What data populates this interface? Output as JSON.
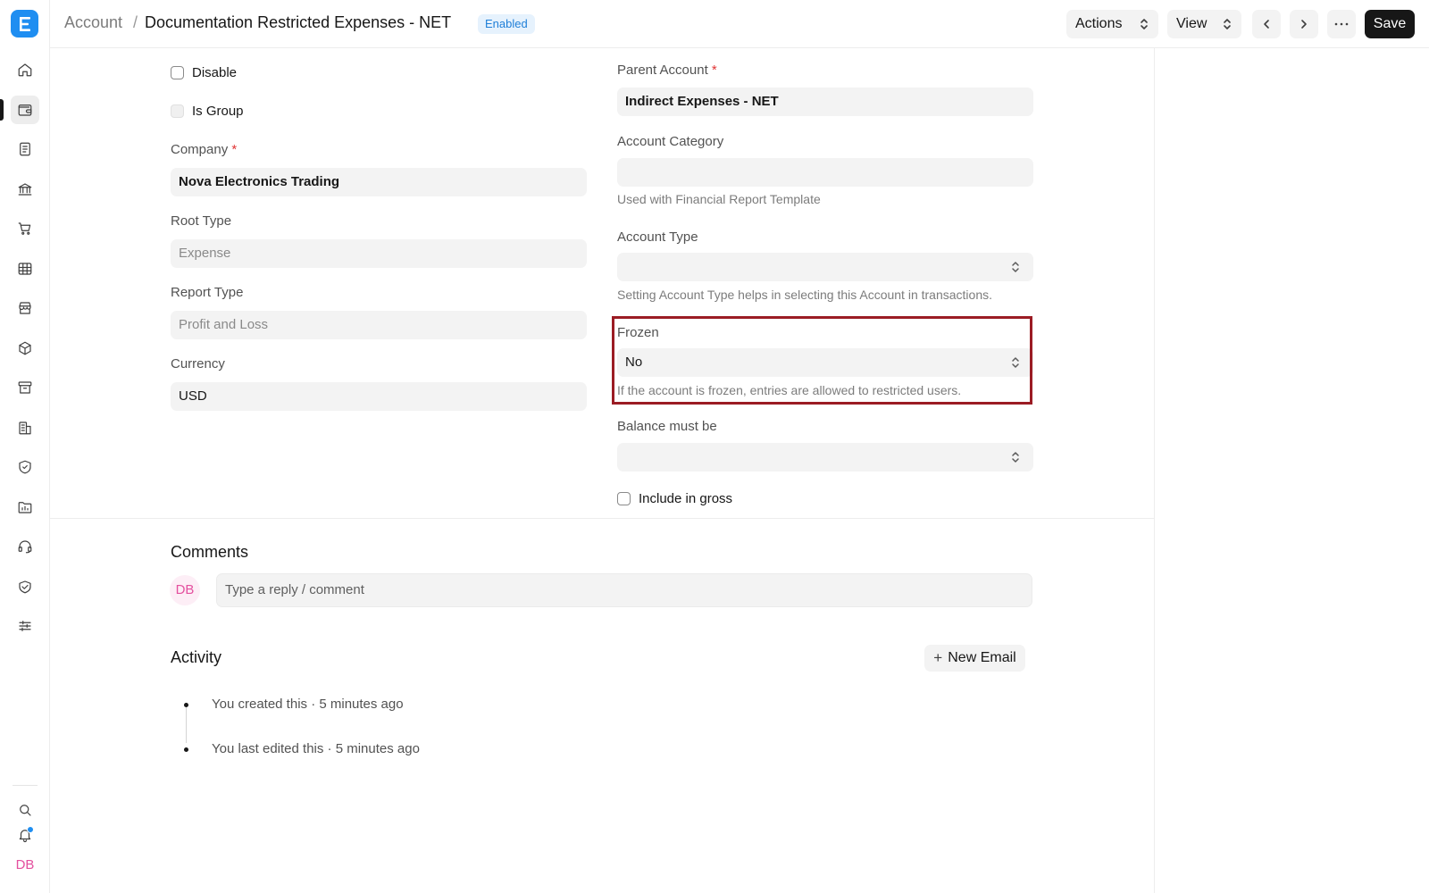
{
  "header": {
    "breadcrumb_parent": "Account",
    "breadcrumb_separator": "/",
    "title": "Documentation Restricted Expenses - NET",
    "status": "Enabled",
    "actions_label": "Actions",
    "view_label": "View",
    "save_label": "Save"
  },
  "sidebar": {
    "items": [
      "home-icon",
      "wallet-icon",
      "document-icon",
      "bank-icon",
      "cart-icon",
      "table-icon",
      "store-icon",
      "package-icon",
      "archive-icon",
      "building-icon",
      "shield-icon",
      "folder-icon",
      "headset-icon",
      "handshake-icon",
      "sliders-icon"
    ],
    "active_index": 1,
    "user_initials": "DB"
  },
  "form": {
    "disable_label": "Disable",
    "is_group_label": "Is Group",
    "company": {
      "label": "Company",
      "value": "Nova Electronics Trading"
    },
    "root_type": {
      "label": "Root Type",
      "value": "Expense"
    },
    "report_type": {
      "label": "Report Type",
      "value": "Profit and Loss"
    },
    "currency": {
      "label": "Currency",
      "value": "USD"
    },
    "parent_account": {
      "label": "Parent Account",
      "value": "Indirect Expenses - NET"
    },
    "account_category": {
      "label": "Account Category",
      "value": "",
      "description": "Used with Financial Report Template"
    },
    "account_type": {
      "label": "Account Type",
      "value": "",
      "description": "Setting Account Type helps in selecting this Account in transactions."
    },
    "frozen": {
      "label": "Frozen",
      "value": "No",
      "description": "If the account is frozen, entries are allowed to restricted users."
    },
    "balance_must_be": {
      "label": "Balance must be",
      "value": ""
    },
    "include_in_gross_label": "Include in gross",
    "required_mark": "*"
  },
  "comments": {
    "title": "Comments",
    "avatar_initials": "DB",
    "placeholder": "Type a reply / comment"
  },
  "activity": {
    "title": "Activity",
    "new_email_label": "New Email",
    "new_email_plus": "+",
    "items": [
      "You created this · 5 minutes ago",
      "You last edited this · 5 minutes ago"
    ]
  },
  "colors": {
    "brand": "#1f8ef1",
    "highlight_border": "#9b1c24",
    "avatar": "#e4509f",
    "status_badge_bg": "#e6f2fd"
  }
}
